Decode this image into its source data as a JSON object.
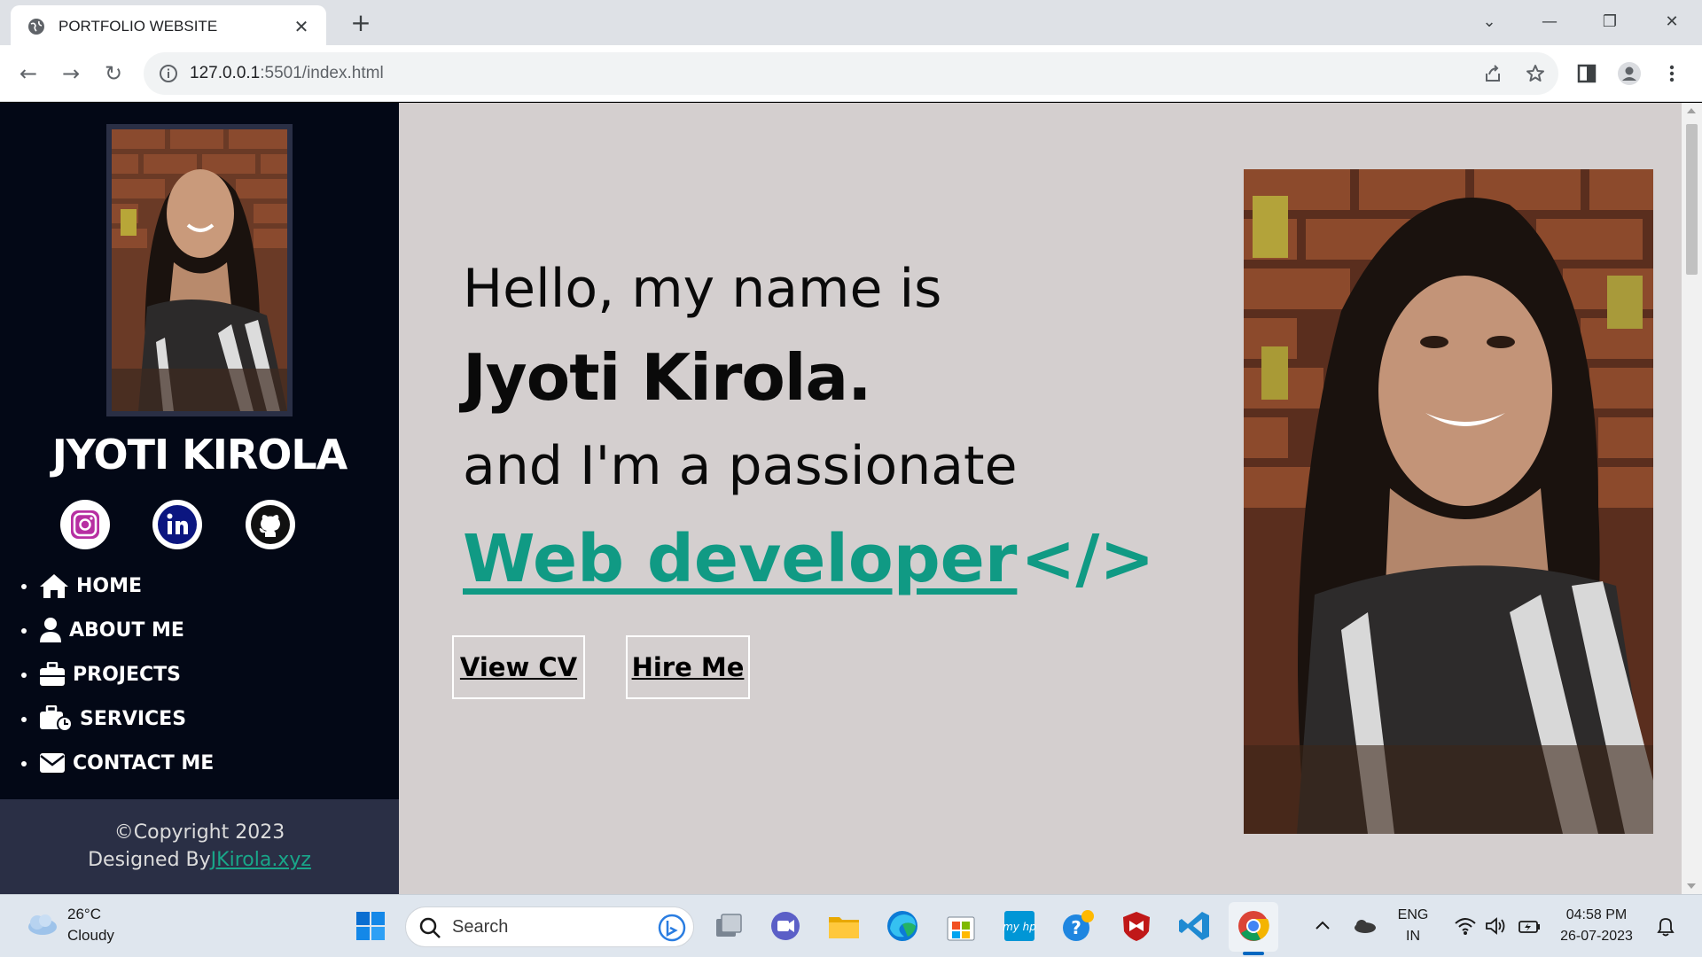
{
  "browser": {
    "tab_title": "PORTFOLIO WEBSITE",
    "tab_close": "✕",
    "new_tab": "+",
    "url_host": "127.0.0.1",
    "url_rest": ":5501/index.html",
    "back": "←",
    "forward": "→",
    "reload": "↻",
    "minimize": "—",
    "restore": "❐",
    "close": "✕",
    "tab_search": "⌄"
  },
  "sidebar": {
    "name": "JYOTI KIROLA",
    "social": [
      {
        "icon": "instagram-icon",
        "color": "#c13584"
      },
      {
        "icon": "linkedin-icon",
        "color": "#0a1a7a"
      },
      {
        "icon": "github-icon",
        "color": "#111111"
      }
    ],
    "nav": [
      {
        "label": "HOME",
        "icon": "home-icon"
      },
      {
        "label": "ABOUT ME",
        "icon": "user-icon"
      },
      {
        "label": "PROJECTS",
        "icon": "briefcase-icon"
      },
      {
        "label": "SERVICES",
        "icon": "business-time-icon"
      },
      {
        "label": "CONTACT ME",
        "icon": "envelope-icon"
      }
    ],
    "footer_copyright": "©Copyright 2023",
    "footer_designed": "Designed By",
    "footer_link": "JKirola.xyz"
  },
  "hero": {
    "line1": "Hello, my name is",
    "name": "Jyoti Kirola.",
    "line3": "and I'm a passionate",
    "role": "Web developer ",
    "role_symbol": "</>",
    "btn_cv": "View CV",
    "btn_hire": "Hire Me"
  },
  "taskbar": {
    "temperature": "26°C",
    "weather": "Cloudy",
    "search": "Search",
    "lang_top": "ENG",
    "lang_bottom": "IN",
    "time": "04:58 PM",
    "date": "26-07-2023"
  },
  "colors": {
    "accent": "#109a84",
    "sidebar_bg": "#030816",
    "footer_bg": "#2a2f45",
    "page_bg": "#d4cfcf"
  }
}
